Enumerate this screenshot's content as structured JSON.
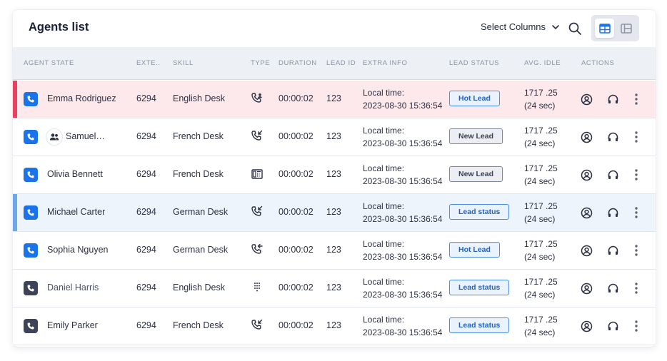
{
  "header": {
    "title": "Agents list",
    "select_columns_label": "Select Columns",
    "search_icon": "search-icon",
    "view_table_icon": "table-view-icon",
    "view_cards_icon": "card-view-icon"
  },
  "columns": [
    "AGENT STATE",
    "EXTE..",
    "SKILL",
    "TYPE",
    "DURATION",
    "LEAD ID",
    "EXTRA INFO",
    "LEAD STATUS",
    "AVG. IDLE",
    "ACTIONS"
  ],
  "colors": {
    "accent_blue": "#1a73e8",
    "state_dark": "#3d4459",
    "hot_row_bg": "#fde8ec",
    "hot_row_accent": "#e8415f",
    "selected_row_bg": "#eef4fc",
    "selected_row_accent": "#6aa8ee"
  },
  "rows": [
    {
      "state_icon": "phone-blue-icon",
      "name": "Emma Rodriguez",
      "ext": "6294",
      "skill": "English Desk",
      "type_icon": "phone-agent-icon",
      "duration": "00:00:02",
      "lead_id": "123",
      "info_label": "Local time:",
      "info_value": "2023-08-30 15:36:54",
      "lead_status": "Hot Lead",
      "idle_value": "1717 .25",
      "idle_sec": "(24 sec)"
    },
    {
      "state_icon": "phone-blue-icon",
      "name": "Samuel…",
      "ext": "6294",
      "skill": "French Desk",
      "type_icon": "phone-incoming-icon",
      "duration": "00:00:02",
      "lead_id": "123",
      "info_label": "Local time:",
      "info_value": "2023-08-30 15:36:54",
      "lead_status": "New Lead",
      "idle_value": "1717 .25",
      "idle_sec": "(24 sec)"
    },
    {
      "state_icon": "phone-blue-icon",
      "name": "Olivia Bennett",
      "ext": "6294",
      "skill": "French Desk",
      "type_icon": "fax-icon",
      "duration": "00:00:02",
      "lead_id": "123",
      "info_label": "Local time:",
      "info_value": "2023-08-30 15:36:54",
      "lead_status": "New Lead",
      "idle_value": "1717 .25",
      "idle_sec": "(24 sec)"
    },
    {
      "state_icon": "phone-blue-icon",
      "name": "Michael Carter",
      "ext": "6294",
      "skill": "German Desk",
      "type_icon": "phone-incoming-icon",
      "duration": "00:00:02",
      "lead_id": "123",
      "info_label": "Local time:",
      "info_value": "2023-08-30 15:36:54",
      "lead_status": "Lead status",
      "idle_value": "1717 .25",
      "idle_sec": "(24 sec)"
    },
    {
      "state_icon": "phone-blue-icon",
      "name": "Sophia Nguyen",
      "ext": "6294",
      "skill": "German Desk",
      "type_icon": "phone-outgoing-icon",
      "duration": "00:00:02",
      "lead_id": "123",
      "info_label": "Local time:",
      "info_value": "2023-08-30 15:36:54",
      "lead_status": "Hot Lead",
      "idle_value": "1717 .25",
      "idle_sec": "(24 sec)"
    },
    {
      "state_icon": "phone-dark-icon",
      "name": "Daniel Harris",
      "ext": "6294",
      "skill": "English Desk",
      "type_icon": "dialpad-icon",
      "duration": "00:00:02",
      "lead_id": "123",
      "info_label": "Local time:",
      "info_value": "2023-08-30 15:36:54",
      "lead_status": "Lead status",
      "idle_value": "1717 .25",
      "idle_sec": "(24 sec)"
    },
    {
      "state_icon": "phone-dark-icon",
      "name": "Emily Parker",
      "ext": "6294",
      "skill": "French Desk",
      "type_icon": "phone-incoming-icon",
      "duration": "00:00:02",
      "lead_id": "123",
      "info_label": "Local time:",
      "info_value": "2023-08-30 15:36:54",
      "lead_status": "Lead status",
      "idle_value": "1717 .25",
      "idle_sec": "(24 sec)"
    }
  ]
}
